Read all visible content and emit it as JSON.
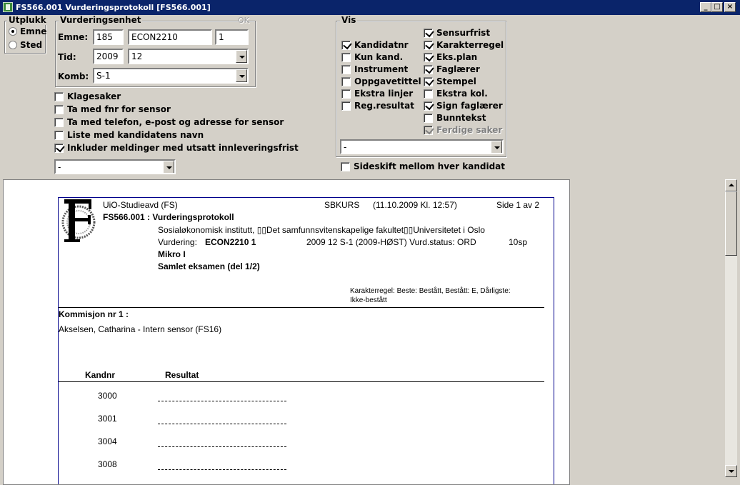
{
  "window": {
    "title": "FS566.001 Vurderingsprotokoll [FS566.001]",
    "min": "_",
    "max": "□",
    "close": "×"
  },
  "utplukk": {
    "caption": "Utplukk",
    "options": [
      {
        "label": "Emne",
        "selected": true
      },
      {
        "label": "Sted",
        "selected": false
      }
    ]
  },
  "vurderingsenhet": {
    "caption": "Vurderingsenhet",
    "ok_label": "OK",
    "emne_label": "Emne:",
    "emne_code": "185",
    "emne_name": "ECON2210",
    "emne_version": "1",
    "tid_label": "Tid:",
    "tid_year": "2009",
    "tid_term": "12",
    "komb_label": "Komb:",
    "komb_value": "S-1"
  },
  "options": [
    {
      "label": "Klagesaker",
      "checked": false
    },
    {
      "label": "Ta med fnr for sensor",
      "checked": false
    },
    {
      "label": "Ta med telefon, e-post og adresse  for sensor",
      "checked": false
    },
    {
      "label": "Liste med kandidatens navn",
      "checked": false
    },
    {
      "label": "Inkluder meldinger med utsatt innleveringsfrist",
      "checked": true
    }
  ],
  "bottom_select": "-",
  "vis": {
    "caption": "Vis",
    "left": [
      {
        "label": "Kandidatnr",
        "checked": true
      },
      {
        "label": "Kun kand.",
        "checked": false
      },
      {
        "label": "Instrument",
        "checked": false
      },
      {
        "label": "Oppgavetittel",
        "checked": false
      },
      {
        "label": "Ekstra linjer",
        "checked": false
      },
      {
        "label": "Reg.resultat",
        "checked": false
      }
    ],
    "right": [
      {
        "label": "Sensurfrist",
        "checked": true,
        "disabled": false
      },
      {
        "label": "Karakterregel",
        "checked": true,
        "disabled": false
      },
      {
        "label": "Eks.plan",
        "checked": true,
        "disabled": false
      },
      {
        "label": "Faglærer",
        "checked": true,
        "disabled": false
      },
      {
        "label": "Stempel",
        "checked": true,
        "disabled": false
      },
      {
        "label": "Ekstra kol.",
        "checked": false,
        "disabled": false
      },
      {
        "label": "Sign faglærer",
        "checked": true,
        "disabled": false
      },
      {
        "label": "Bunntekst",
        "checked": false,
        "disabled": false
      },
      {
        "label": "Ferdige saker",
        "checked": true,
        "disabled": true
      }
    ],
    "select": "-"
  },
  "sideskift": {
    "label": "Sideskift mellom hver kandidat",
    "checked": false
  },
  "report": {
    "org": "UiO-Studieavd (FS)",
    "system": "SBKURS",
    "timestamp": "(11.10.2009 Kl. 12:57)",
    "page": "Side 1 av 2",
    "title": "FS566.001 : Vurderingsprotokoll",
    "institution": "Sosialøkonomisk institutt, ▯▯Det samfunnsvitenskapelige fakultet▯▯Universitetet i Oslo",
    "vurdering_label": "Vurdering:",
    "vurdering_code": "ECON2210 1",
    "vurdering_info": "2009 12 S-1 (2009-HØST) Vurd.status: ORD",
    "credits": "10sp",
    "course_name": "Mikro I",
    "exam_name": "Samlet eksamen (del 1/2)",
    "karakterregel_line1": "Karakterregel: Beste: Bestått, Bestått: E, Dårligste:",
    "karakterregel_line2": "Ikke-bestått",
    "kommisjon": "Kommisjon nr 1  :",
    "sensor": "Akselsen, Catharina - Intern sensor (FS16)",
    "col_kandnr": "Kandnr",
    "col_resultat": "Resultat",
    "candidates": [
      "3000",
      "3001",
      "3004",
      "3008"
    ]
  }
}
